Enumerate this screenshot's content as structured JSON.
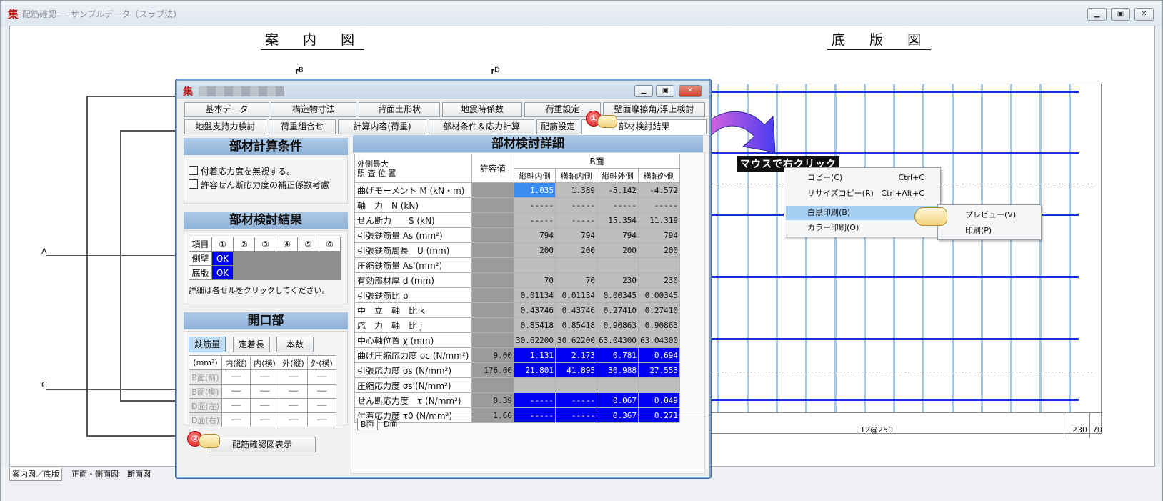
{
  "main": {
    "title": "配筋確認 － サンプルデータ（スラブ法）",
    "logo": "集",
    "heading_left": "案 内 図",
    "heading_right": "底 版 図",
    "markers": [
      "A",
      "C"
    ],
    "bottom_dims": [
      "12@250",
      "230",
      "70"
    ],
    "bottom_tabs": [
      "案内図／底版",
      "正面・側面図",
      "断面図"
    ]
  },
  "dialog": {
    "logo": "集",
    "tabs_row1": [
      "基本データ",
      "構造物寸法",
      "背面土形状",
      "地震時係数",
      "荷重設定",
      "壁面摩擦角/浮上検討"
    ],
    "tabs_row2": [
      "地盤支持力検討",
      "荷重組合せ",
      "計算内容(荷重)",
      "部材条件＆応力計算",
      "配筋設定",
      "部材検討結果"
    ],
    "section_conditions": "部材計算条件",
    "checkbox1": "付着応力度を無視する。",
    "checkbox2": "許容せん断応力度の補正係数考慮",
    "section_results": "部材検討結果",
    "result_grid": {
      "headers": [
        "項目",
        "①",
        "②",
        "③",
        "④",
        "⑤",
        "⑥"
      ],
      "rows": [
        {
          "label": "側壁",
          "status": "OK"
        },
        {
          "label": "底版",
          "status": "OK"
        }
      ],
      "note": "詳細は各セルをクリックしてください。"
    },
    "section_opening": "開口部",
    "opening_buttons": [
      "鉄筋量",
      "定着長",
      "本数"
    ],
    "opening_table": {
      "headers": [
        "(mm²)",
        "内(縦)",
        "内(横)",
        "外(縦)",
        "外(横)"
      ],
      "rows": [
        "B面(前)",
        "B面(奥)",
        "D面(左)",
        "D面(右)"
      ],
      "cell": "──"
    },
    "show_button": "配筋確認図表示",
    "detail_title": "部材検討詳細",
    "detail": {
      "corner1": "外側最大",
      "corner2": "照 査 位 置",
      "allow_header": "許容値",
      "face_header": "B面",
      "col_headers": [
        "縦軸内側",
        "横軸内側",
        "縦軸外側",
        "横軸外側"
      ],
      "rows": [
        {
          "label": "曲げモーメント M (kN・m)",
          "allow": "",
          "v": [
            "1.035",
            "1.389",
            "-5.142",
            "-4.572"
          ]
        },
        {
          "label": "軸　力　N (kN)",
          "allow": "",
          "v": [
            "-----",
            "-----",
            "-----",
            "-----"
          ]
        },
        {
          "label": "せん断力　　S (kN)",
          "allow": "",
          "v": [
            "-----",
            "-----",
            "15.354",
            "11.319"
          ]
        },
        {
          "label": "引張鉄筋量 As (mm²)",
          "allow": "",
          "v": [
            "794",
            "794",
            "794",
            "794"
          ]
        },
        {
          "label": "引張鉄筋周長　U (mm)",
          "allow": "",
          "v": [
            "200",
            "200",
            "200",
            "200"
          ]
        },
        {
          "label": "圧縮鉄筋量 As'(mm²)",
          "allow": "",
          "v": [
            "",
            "",
            "",
            ""
          ]
        },
        {
          "label": "有効部材厚 d (mm)",
          "allow": "",
          "v": [
            "70",
            "70",
            "230",
            "230"
          ]
        },
        {
          "label": "引張鉄筋比 p",
          "allow": "",
          "v": [
            "0.01134",
            "0.01134",
            "0.00345",
            "0.00345"
          ]
        },
        {
          "label": "中　立　軸　比 k",
          "allow": "",
          "v": [
            "0.43746",
            "0.43746",
            "0.27410",
            "0.27410"
          ]
        },
        {
          "label": "応　力　軸　比 j",
          "allow": "",
          "v": [
            "0.85418",
            "0.85418",
            "0.90863",
            "0.90863"
          ]
        },
        {
          "label": "中心軸位置 χ (mm)",
          "allow": "",
          "v": [
            "30.62200",
            "30.62200",
            "63.04300",
            "63.04300"
          ]
        },
        {
          "label": "曲げ圧縮応力度 σc (N/mm²)",
          "allow": "9.00",
          "v": [
            "1.131",
            "2.173",
            "0.781",
            "0.694"
          ]
        },
        {
          "label": "引張応力度 σs (N/mm²)",
          "allow": "176.00",
          "v": [
            "21.801",
            "41.895",
            "30.988",
            "27.553"
          ]
        },
        {
          "label": "圧縮応力度 σs'(N/mm²)",
          "allow": "",
          "v": [
            "",
            "",
            "",
            ""
          ]
        },
        {
          "label": "せん断応力度　τ (N/mm²)",
          "allow": "0.39",
          "v": [
            "-----",
            "-----",
            "0.067",
            "0.049"
          ]
        },
        {
          "label": "付着応力度 τ0 (N/mm²)",
          "allow": "1.60",
          "v": [
            "-----",
            "-----",
            "0.367",
            "0.271"
          ]
        }
      ]
    },
    "face_tabs": [
      "B面",
      "D面"
    ]
  },
  "callout": "マウスで右クリック",
  "context_menu": {
    "items": [
      {
        "label": "コピー(C)",
        "shortcut": "Ctrl+C"
      },
      {
        "label": "リサイズコピー(R)",
        "shortcut": "Ctrl+Alt+C"
      },
      {
        "label": "白黒印刷(B)",
        "shortcut": ""
      },
      {
        "label": "カラー印刷(O)",
        "shortcut": ""
      }
    ],
    "submenu": [
      "プレビュー(V)",
      "印刷(P)"
    ]
  },
  "badges": [
    "①",
    "②"
  ],
  "colors": {
    "accent_blue": "#0000f0",
    "header_blue": "#8fb2d8",
    "menu_highlight": "#a7cff2",
    "beam_blue": "#1c2fe0"
  }
}
